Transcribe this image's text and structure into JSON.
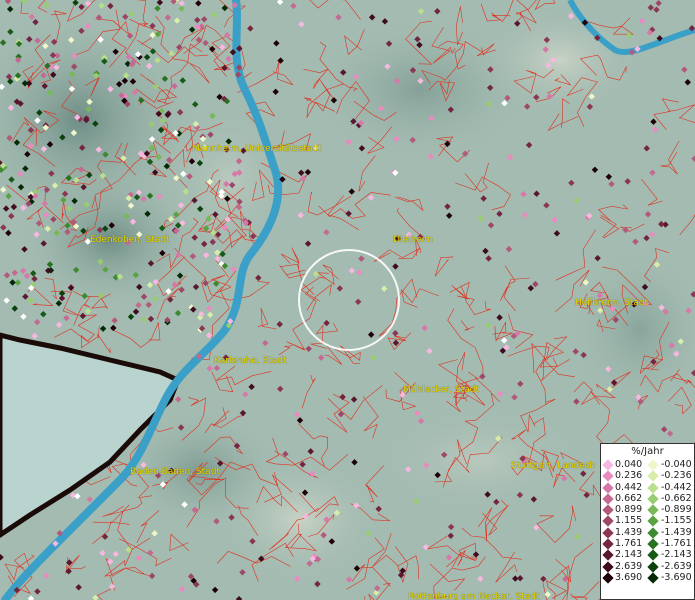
{
  "map": {
    "cities": [
      {
        "id": "mannheim",
        "label": "Mannheim, Universitätsstadt"
      },
      {
        "id": "edenkoben",
        "label": "Edenkoben, Stadt"
      },
      {
        "id": "dielheim",
        "label": "Dielheim"
      },
      {
        "id": "heilbronn",
        "label": "Heilbronn, Stadt"
      },
      {
        "id": "karlsruhe",
        "label": "Karlsruhe, Stadt"
      },
      {
        "id": "muehlacker",
        "label": "Mühlacker, Stadt"
      },
      {
        "id": "stuttgart",
        "label": "Stuttgart, Landesh"
      },
      {
        "id": "badenbaden",
        "label": "Baden-Baden, Stadt"
      },
      {
        "id": "rottenburg",
        "label": "Rottenburg am Neckar, Stadt"
      }
    ],
    "colors": {
      "river": "#3aa0c8",
      "borders": "#e0301e",
      "lake": "#b9d3ce",
      "selection_circle": "#ffffff"
    }
  },
  "legend": {
    "title": "%/Jahr",
    "positive": [
      {
        "value": "0.040",
        "color": "#f6b8e0"
      },
      {
        "value": "0.236",
        "color": "#e88cc0"
      },
      {
        "value": "0.442",
        "color": "#d679a8"
      },
      {
        "value": "0.662",
        "color": "#c46a92"
      },
      {
        "value": "0.899",
        "color": "#b25a7c"
      },
      {
        "value": "1.155",
        "color": "#9e4868"
      },
      {
        "value": "1.439",
        "color": "#8a3654"
      },
      {
        "value": "1.761",
        "color": "#742640"
      },
      {
        "value": "2.143",
        "color": "#5a1830"
      },
      {
        "value": "2.639",
        "color": "#3e0c1e"
      },
      {
        "value": "3.690",
        "color": "#1e0008"
      }
    ],
    "negative": [
      {
        "value": "-0.040",
        "color": "#eef7c8"
      },
      {
        "value": "-0.236",
        "color": "#d8eea8"
      },
      {
        "value": "-0.442",
        "color": "#b8e08c"
      },
      {
        "value": "-0.662",
        "color": "#98cc70"
      },
      {
        "value": "-0.899",
        "color": "#78b858"
      },
      {
        "value": "-1.155",
        "color": "#5aa244"
      },
      {
        "value": "-1.439",
        "color": "#3e8a30"
      },
      {
        "value": "-1.761",
        "color": "#287222"
      },
      {
        "value": "-2.143",
        "color": "#165a16"
      },
      {
        "value": "-2.639",
        "color": "#0a420c"
      },
      {
        "value": "-3.690",
        "color": "#022a04"
      }
    ]
  }
}
